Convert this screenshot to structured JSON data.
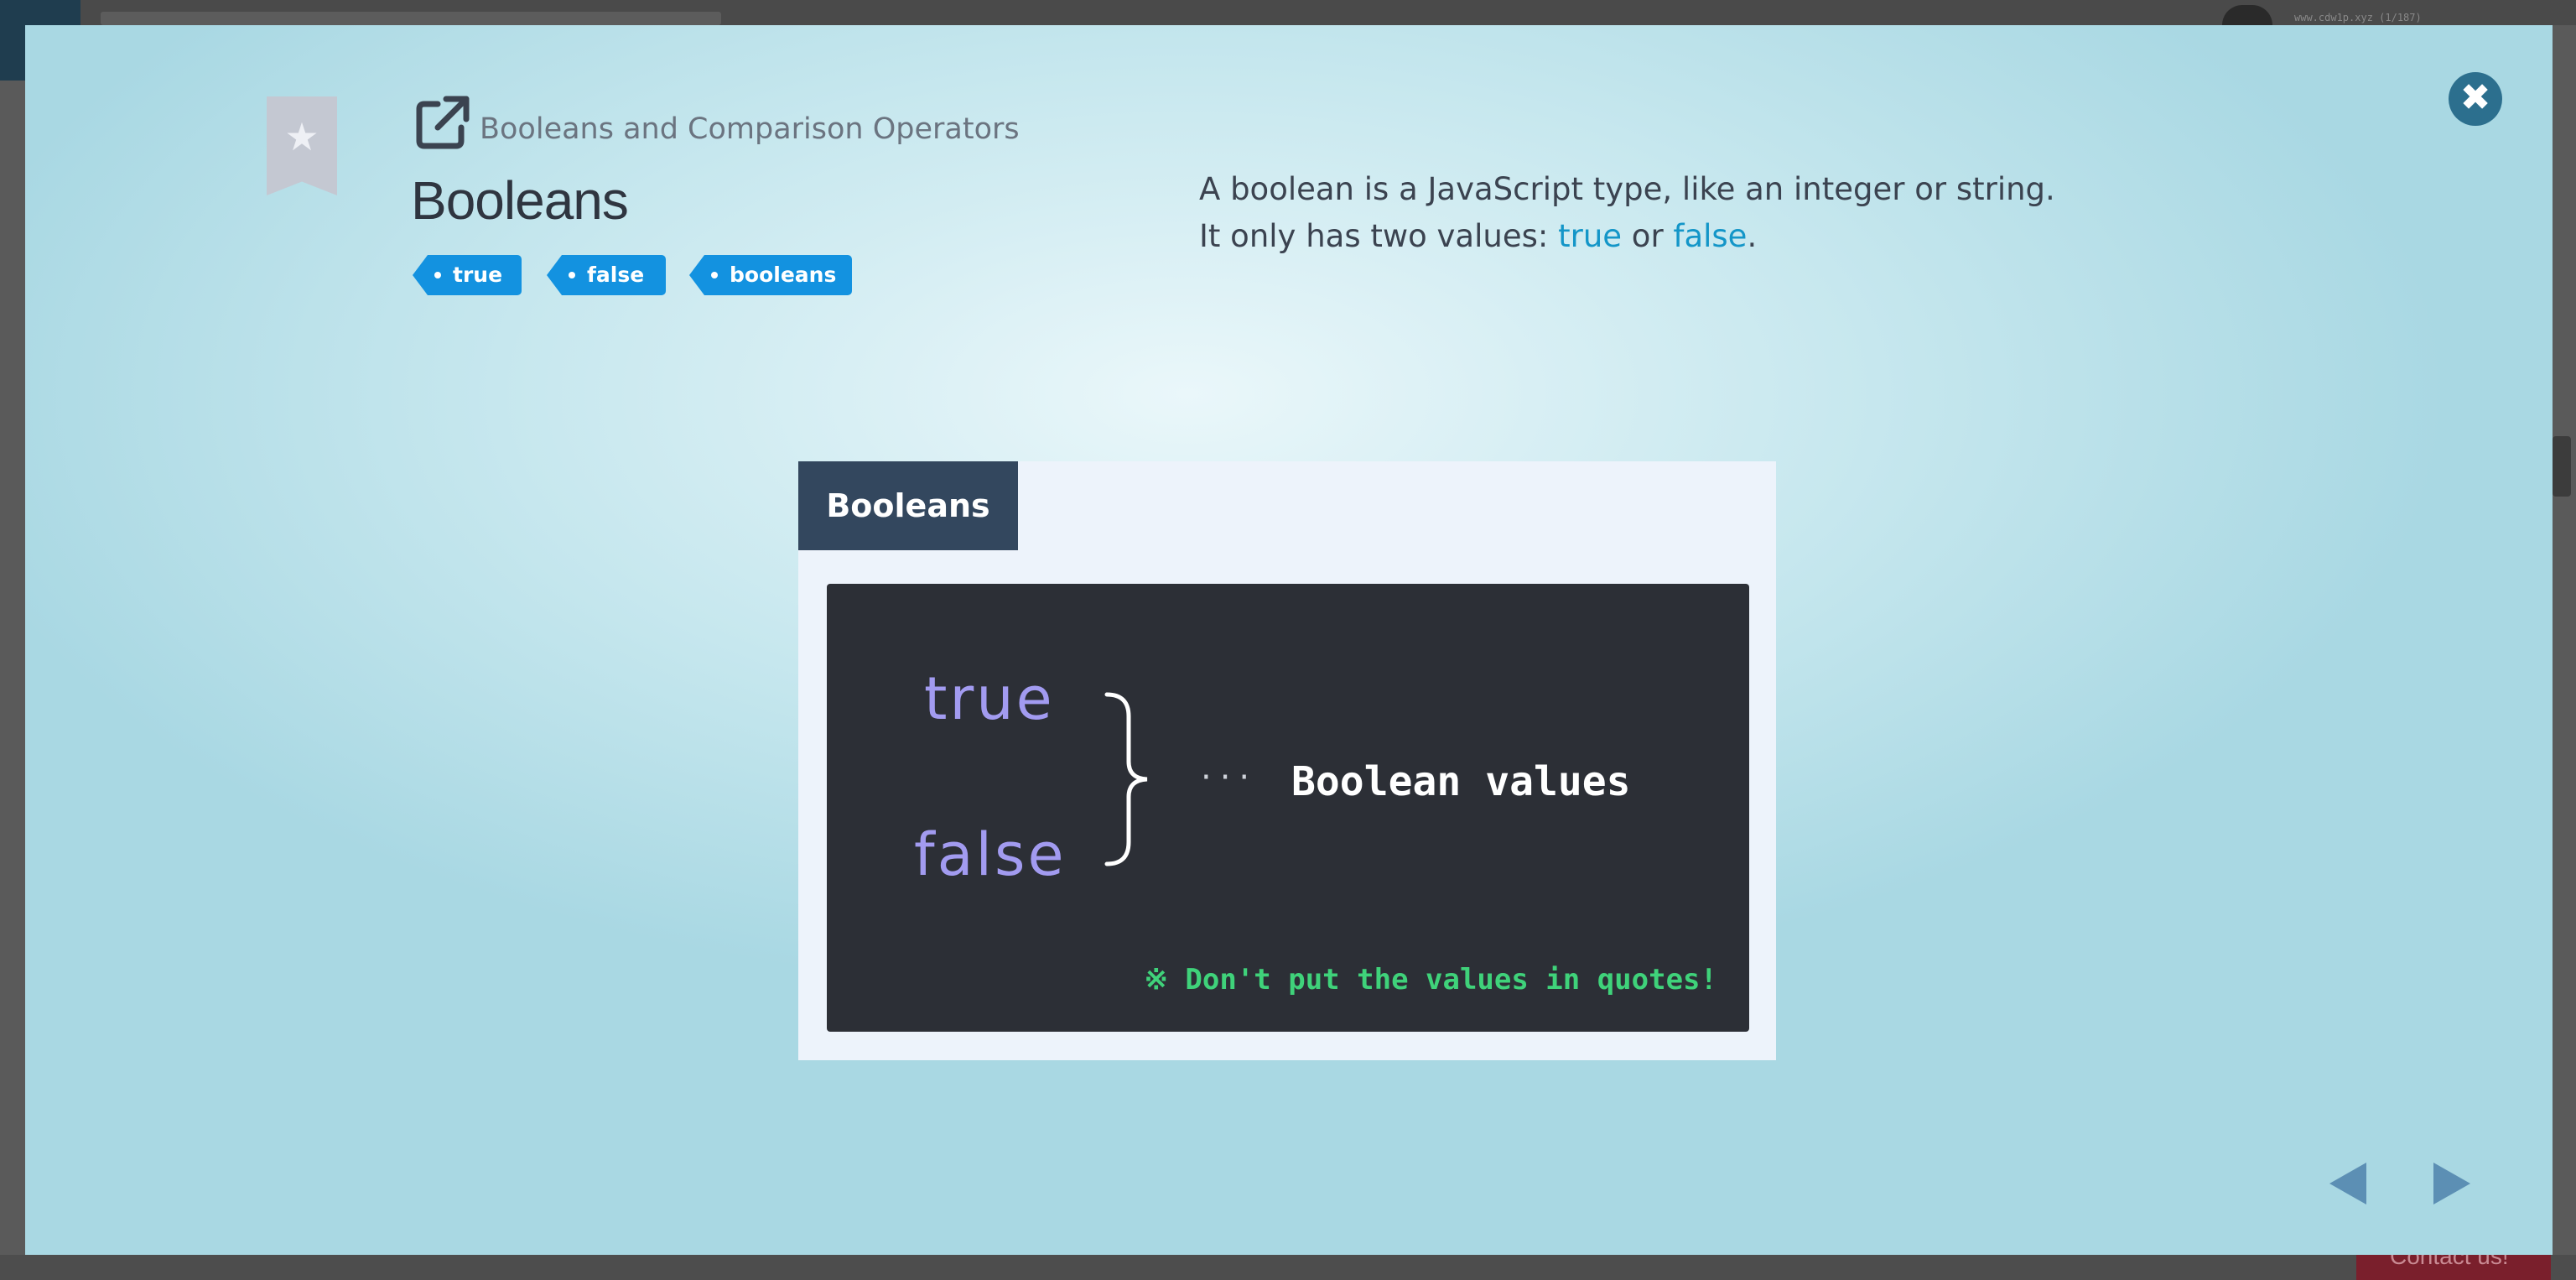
{
  "background": {
    "url_text": "www.cdw1p.xyz (1/187)",
    "contact_label": "Contact us!"
  },
  "modal": {
    "close_icon": "close-icon",
    "bookmark_icon": "star-bookmark-icon",
    "external_link_icon": "external-link-icon",
    "breadcrumb": "Booleans and Comparison Operators",
    "title": "Booleans",
    "tags": [
      "true",
      "false",
      "booleans"
    ],
    "description": {
      "line1": "A boolean is a JavaScript type, like an integer or string.",
      "line2_prefix": "It only has two values: ",
      "value_true": "true",
      "or": " or ",
      "value_false": "false",
      "period": "."
    },
    "slide": {
      "tab_label": "Booleans",
      "value_true": "true",
      "value_false": "false",
      "dots": "···",
      "caption": "Boolean values",
      "note": "※ Don't put the values in quotes!"
    },
    "nav": {
      "prev_icon": "triangle-left-icon",
      "next_icon": "triangle-right-icon"
    }
  },
  "colors": {
    "accent": "#1392e0",
    "keyword": "#1496c8",
    "slide_keyword": "#a29bf0",
    "note": "#3fd27a",
    "close": "#2c6f8e"
  }
}
